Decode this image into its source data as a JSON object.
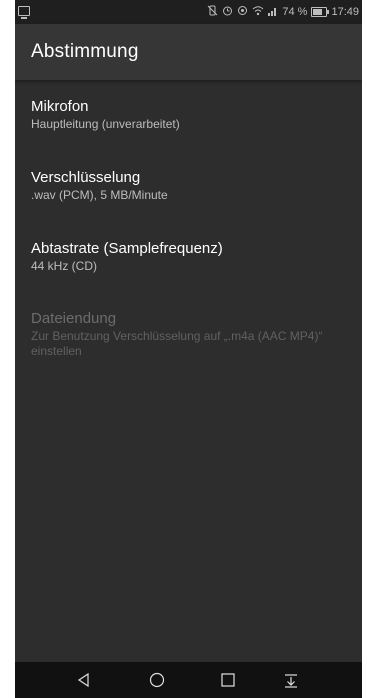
{
  "status_bar": {
    "battery_percent": "74 %",
    "battery_level": 0.74,
    "time": "17:49",
    "icons": [
      "notification-icon",
      "vibrate-off-icon",
      "alarm-icon",
      "eye-comfort-icon",
      "wifi-icon",
      "signal-icon",
      "battery-icon"
    ]
  },
  "toolbar": {
    "title": "Abstimmung"
  },
  "preferences": [
    {
      "title": "Mikrofon",
      "summary": "Hauptleitung (unverarbeitet)",
      "enabled": true
    },
    {
      "title": "Verschlüsselung",
      "summary": ".wav (PCM), 5 MB/Minute",
      "enabled": true
    },
    {
      "title": "Abtastrate (Samplefrequenz)",
      "summary": "44 kHz (CD)",
      "enabled": true
    },
    {
      "title": "Dateiendung",
      "summary": "Zur Benutzung Verschlüsselung auf „.m4a (AAC MP4)“ einstellen",
      "enabled": false
    }
  ],
  "nav_bar": {
    "buttons": [
      "back-icon",
      "home-icon",
      "recents-icon",
      "notification-pull-icon"
    ]
  },
  "colors": {
    "background": "#2d2d2d",
    "toolbar": "#363636",
    "status_bar": "#1f1f1f",
    "nav_bar": "#111111",
    "primary_text": "#ffffff",
    "secondary_text": "#bdbdbd",
    "disabled_text": "#6c6c6c"
  }
}
